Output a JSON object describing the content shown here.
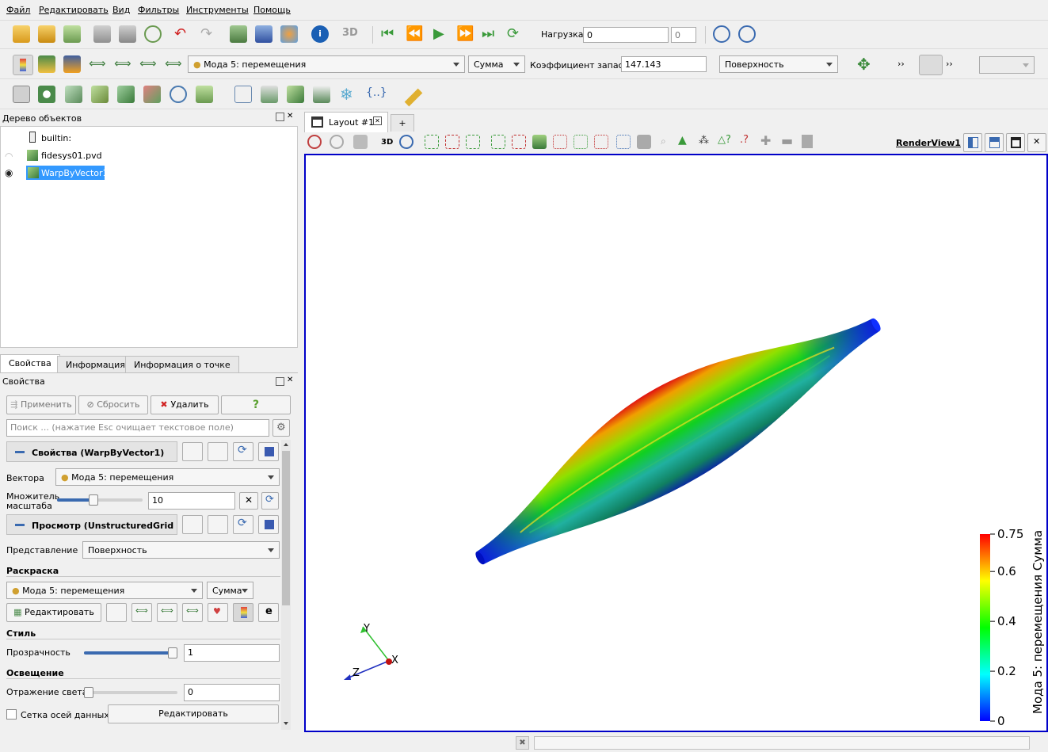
{
  "menu": [
    "Файл",
    "Редактировать",
    "Вид",
    "Фильтры",
    "Инструменты",
    "Помощь"
  ],
  "toolbar1": {
    "load_label": "Нагрузка:",
    "load_value": "0",
    "load_spin_value": "0"
  },
  "toolbar2": {
    "array_select": "Мода 5: перемещения",
    "component_select": "Сумма",
    "safety_factor_label": "Коэффициент запаса:",
    "safety_factor_value": "147.143",
    "representation_select": "Поверхность",
    "overflow_label": "››"
  },
  "pipeline": {
    "title": "Дерево объектов",
    "items": [
      {
        "label": "builtin:",
        "visible": false
      },
      {
        "label": "fidesys01.pvd",
        "visible": false
      },
      {
        "label": "WarpByVector1",
        "visible": true,
        "selected": true
      }
    ]
  },
  "props_tabs": [
    "Свойства",
    "Информация",
    "Информация о точке"
  ],
  "props": {
    "title": "Свойства",
    "apply": "Применить",
    "reset": "Сбросить",
    "delete": "Удалить",
    "help": "?",
    "search_placeholder": "Поиск ... (нажатие Esc очищает текстовое поле)",
    "section_props": "Свойства (WarpByVector1)",
    "vectors_label": "Вектора",
    "vectors_value": "Мода 5: перемещения",
    "scale_label_1": "Множитель",
    "scale_label_2": "масштаба",
    "scale_value": "10",
    "scale_slider_fraction": 0.42,
    "section_display": "Просмотр (UnstructuredGridRe",
    "representation_label": "Представление",
    "representation_value": "Поверхность",
    "coloring_header": "Раскраска",
    "coloring_array": "Мода 5: перемещения",
    "coloring_component": "Сумма",
    "edit_label": "Редактировать",
    "style_header": "Стиль",
    "opacity_label": "Прозрачность",
    "opacity_value": "1",
    "opacity_fraction": 1.0,
    "lighting_header": "Освещение",
    "specular_label": "Отражение света",
    "specular_value": "0",
    "specular_fraction": 0.0,
    "data_axes_label": "Сетка осей данных",
    "data_axes_edit": "Редактировать"
  },
  "layout": {
    "tab_label": "Layout #1",
    "add_tab": "+",
    "view_name": "RenderView1",
    "view_3d": "3D"
  },
  "colorbar": {
    "title": "Мода 5: перемещения Сумма",
    "ticks": [
      "0.75",
      "0.6",
      "0.4",
      "0.2",
      "0"
    ],
    "colors": [
      "#ff0000",
      "#ffff00",
      "#00ff00",
      "#00ffff",
      "#0000ff"
    ]
  },
  "axes": {
    "x": "X",
    "y": "Y",
    "z": "Z"
  },
  "status": {
    "close_glyph": "✖"
  },
  "colors": {
    "selection": "#3399ff",
    "view_border": "#0000c8"
  }
}
